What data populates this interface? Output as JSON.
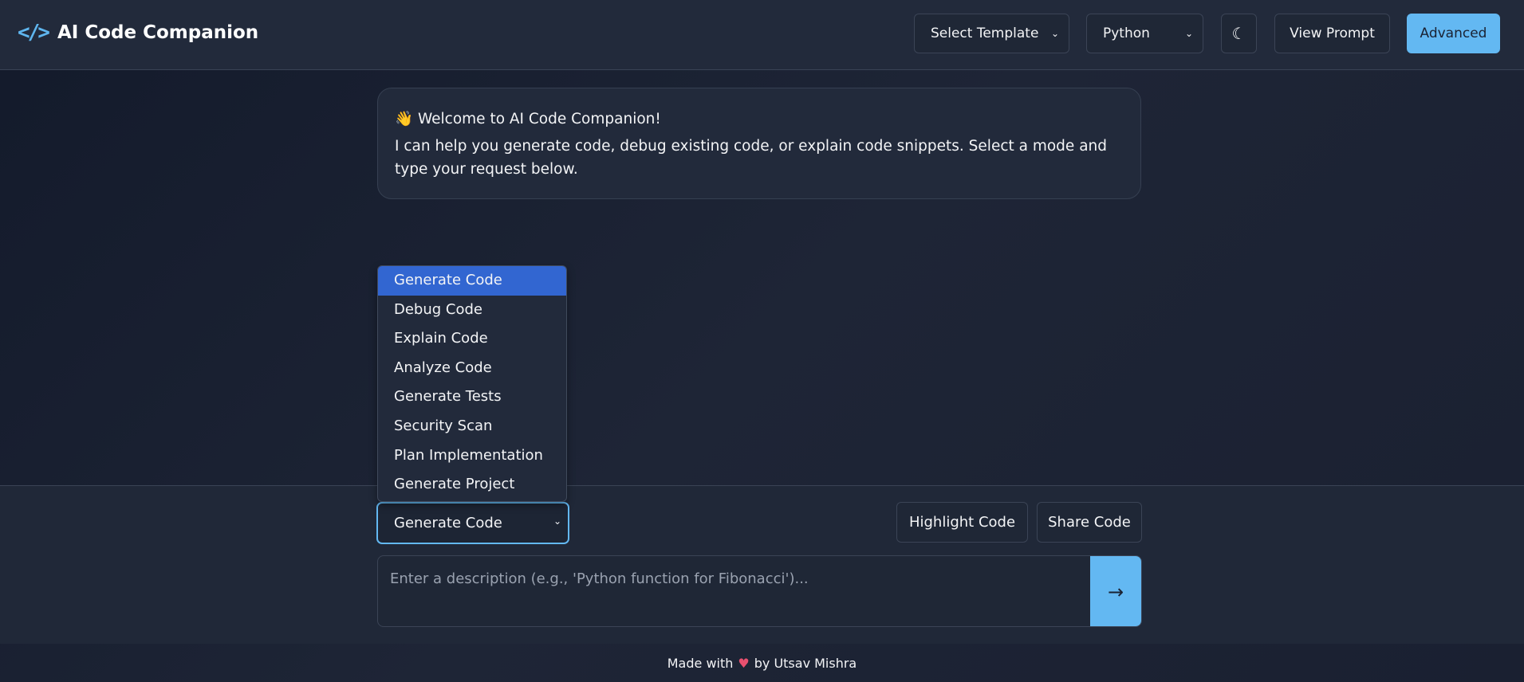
{
  "header": {
    "title": "AI Code Companion",
    "logo_icon": "code-icon",
    "template_select": "Select Template",
    "language_select": "Python",
    "theme_icon": "moon-icon",
    "view_prompt": "View Prompt",
    "advanced": "Advanced"
  },
  "welcome": {
    "emoji": "👋",
    "heading": "Welcome to AI Code Companion!",
    "body": "I can help you generate code, debug existing code, or explain code snippets. Select a mode and type your request below."
  },
  "mode": {
    "selected": "Generate Code",
    "options": [
      "Generate Code",
      "Debug Code",
      "Explain Code",
      "Analyze Code",
      "Generate Tests",
      "Security Scan",
      "Plan Implementation",
      "Generate Project"
    ]
  },
  "actions": {
    "highlight": "Highlight Code",
    "share": "Share Code"
  },
  "input": {
    "placeholder": "Enter a description (e.g., 'Python function for Fibonacci')...",
    "value": "",
    "send_icon": "arrow-right-icon"
  },
  "footer": {
    "prefix": "Made with",
    "heart": "♥",
    "suffix": "by Utsav Mishra"
  },
  "colors": {
    "accent": "#63b8f2",
    "highlight": "#3266d1",
    "background": "#1e2536"
  }
}
